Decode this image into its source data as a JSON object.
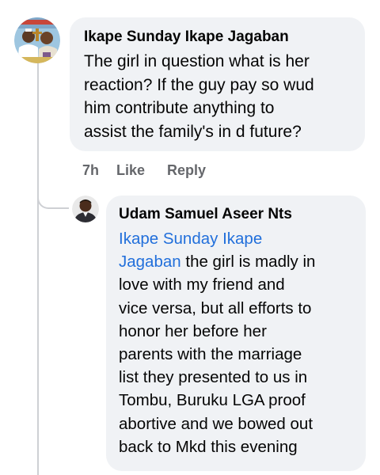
{
  "comment": {
    "author": "Ikape Sunday Ikape Jagaban",
    "lines": [
      "The girl in question what is her",
      "reaction? If the guy pay so wud",
      "him contribute anything to",
      "assist the family's in d future?"
    ],
    "time": "7h",
    "like_label": "Like",
    "reply_label": "Reply",
    "avatar_icon": "profile-photo-two-people"
  },
  "reply": {
    "author": "Udam Samuel Aseer Nts",
    "mention_line1": "Ikape Sunday Ikape",
    "mention_line2": "Jagaban",
    "line2_rest": " the girl is madly in",
    "lines": [
      "love with my friend and",
      "vice versa, but all efforts to",
      "honor her before her",
      "parents with the marriage",
      "list they presented to us in",
      "Tombu, Buruku LGA proof",
      "abortive and we bowed out",
      "back to Mkd this evening"
    ],
    "avatar_icon": "profile-photo-person"
  },
  "colors": {
    "bubble": "#f0f2f5",
    "mention": "#216fdb",
    "meta": "#65676b",
    "thread_line": "#ced0d4"
  }
}
